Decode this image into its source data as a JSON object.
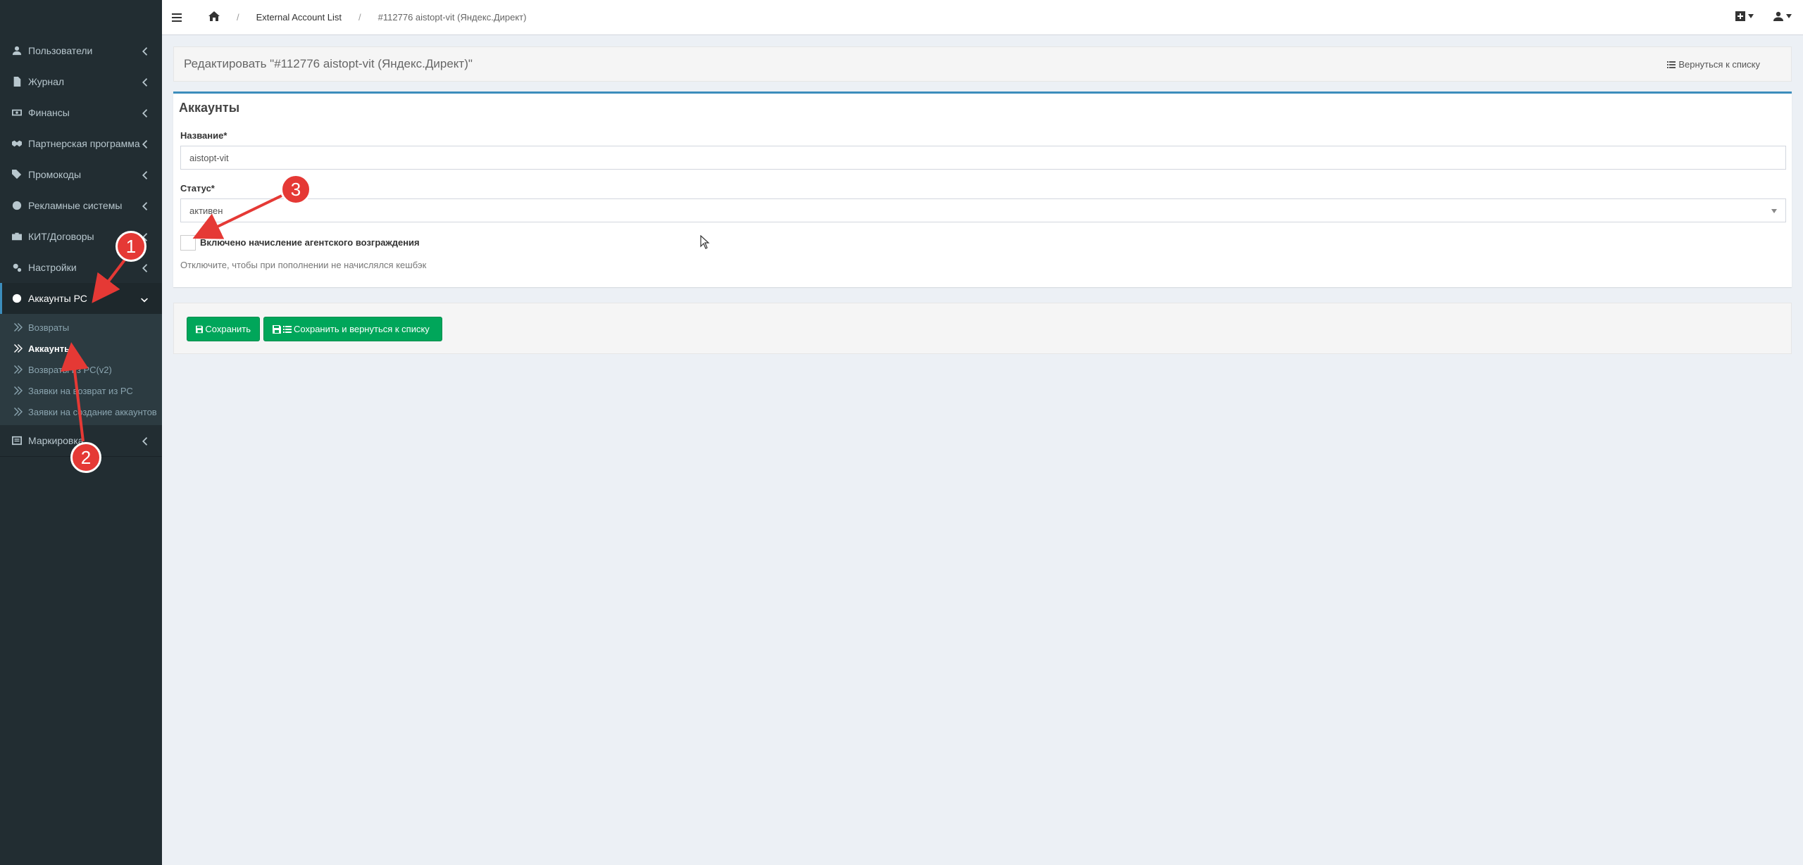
{
  "sidebar": {
    "items": [
      {
        "label": "Пользователи",
        "icon": "user-icon"
      },
      {
        "label": "Журнал",
        "icon": "file-icon"
      },
      {
        "label": "Финансы",
        "icon": "money-icon"
      },
      {
        "label": "Партнерская программа",
        "icon": "handshake-icon"
      },
      {
        "label": "Промокоды",
        "icon": "tags-icon"
      },
      {
        "label": "Рекламные системы",
        "icon": "globe-icon"
      },
      {
        "label": "КИТ/Договоры",
        "icon": "briefcase-icon"
      },
      {
        "label": "Настройки",
        "icon": "gears-icon"
      },
      {
        "label": "Аккаунты РС",
        "icon": "circle-icon"
      }
    ],
    "submenu": [
      {
        "label": "Возвраты"
      },
      {
        "label": "Аккаунты"
      },
      {
        "label": "Возвраты из РС(v2)"
      },
      {
        "label": "Заявки на возврат из РС"
      },
      {
        "label": "Заявки на создание аккаунтов"
      }
    ],
    "last_item": {
      "label": "Маркировка",
      "icon": "list-icon"
    }
  },
  "breadcrumb": {
    "level1": "External Account List",
    "level2": "#112776 aistopt-vit (Яндекс.Директ)"
  },
  "header": {
    "title": "Редактировать \"#112776 aistopt-vit (Яндекс.Директ)\"",
    "back_link": "Вернуться к списку"
  },
  "form": {
    "box_title": "Аккаунты",
    "name_label": "Название*",
    "name_value": "aistopt-vit",
    "status_label": "Статус*",
    "status_value": "активен",
    "checkbox_label": "Включено начисление агентского возграждения",
    "help_text": "Отключите, чтобы при пополнении не начислялся кешбэк"
  },
  "buttons": {
    "save": "Сохранить",
    "save_back": "Сохранить и вернуться к списку"
  },
  "annotations": [
    "1",
    "2",
    "3"
  ],
  "colors": {
    "sidebar_bg": "#222d32",
    "accent": "#3c8dbc",
    "button_green": "#00a65a",
    "annotation_red": "#e53935"
  }
}
